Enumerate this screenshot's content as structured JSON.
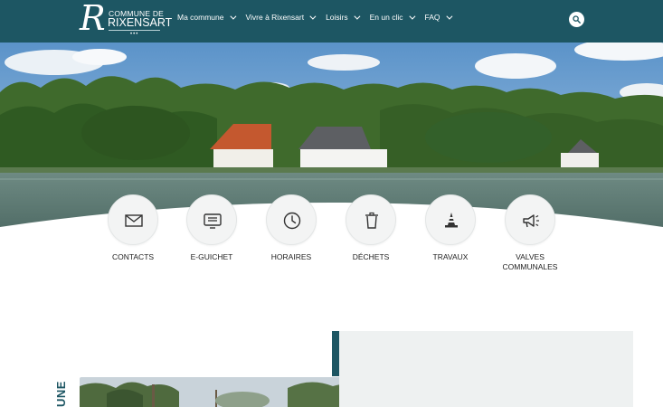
{
  "header": {
    "logo": {
      "top_text": "COMMUNE DE",
      "main_text": "RIXENSART",
      "dots": "•••"
    },
    "nav": [
      {
        "label": "Ma commune"
      },
      {
        "label": "Vivre à Rixensart"
      },
      {
        "label": "Loisirs"
      },
      {
        "label": "En un clic"
      },
      {
        "label": "FAQ"
      }
    ],
    "search_icon": "search-icon"
  },
  "quick_links": [
    {
      "label": "CONTACTS",
      "icon": "envelope-icon"
    },
    {
      "label": "E-GUICHET",
      "icon": "counter-icon"
    },
    {
      "label": "HORAIRES",
      "icon": "clock-icon"
    },
    {
      "label": "DÉCHETS",
      "icon": "trash-icon"
    },
    {
      "label": "TRAVAUX",
      "icon": "traffic-cone-icon"
    },
    {
      "label": "VALVES COMMUNALES",
      "icon": "megaphone-icon"
    }
  ],
  "section": {
    "vertical_label": "UNE"
  },
  "colors": {
    "brand": "#1d5663",
    "panel": "#eef1f1"
  }
}
